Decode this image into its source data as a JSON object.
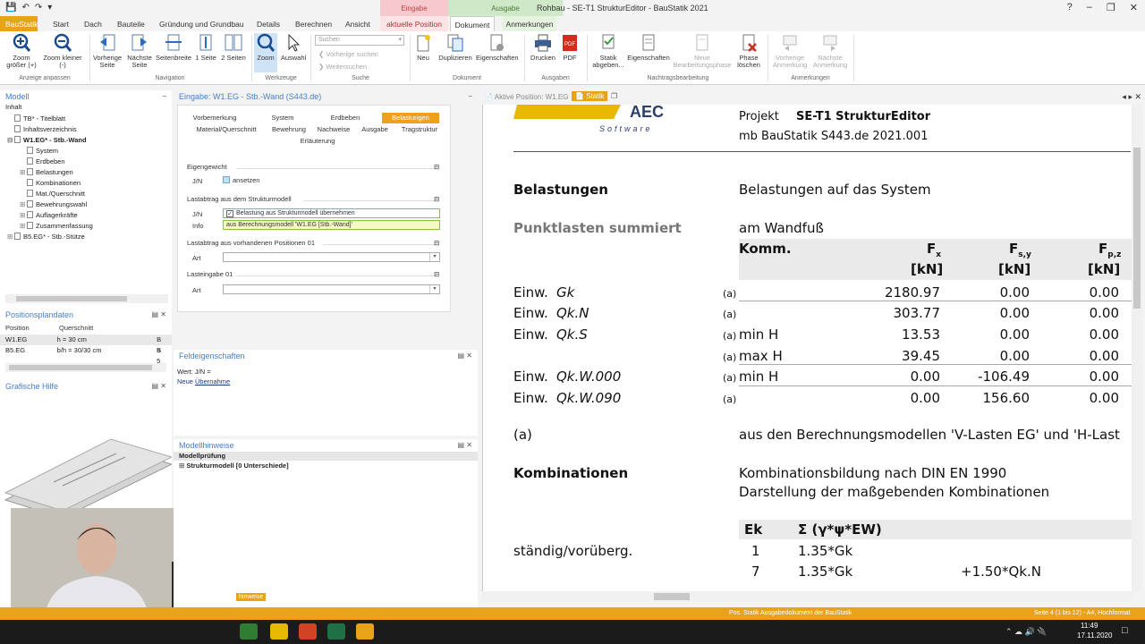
{
  "titlebar": {
    "title": "Rohbau - SE-T1 StrukturEditor - BauStatik 2021",
    "ctx_eingabe": "Eingabe",
    "ctx_ausgabe": "Ausgabe",
    "ctx_eingabe_tab": "aktuelle Position"
  },
  "tabs": [
    "BauStatik",
    "Start",
    "Dach",
    "Bauteile",
    "Gründung und Grundbau",
    "Details",
    "Berechnen",
    "Ansicht",
    "aktuelle Position",
    "Dokument",
    "Anmerkungen"
  ],
  "ribbon": {
    "zoom_plus": "Zoom größer (+)",
    "zoom_minus": "Zoom kleiner (-)",
    "group_anzeige": "Anzeige anpassen",
    "prev_page": "Vorherige Seite",
    "next_page": "Nächste Seite",
    "page_width": "Seitenbreite",
    "one_page": "1 Seite",
    "two_pages": "2 Seiten",
    "group_nav": "Navigation",
    "zoom": "Zoom",
    "select": "Auswahl",
    "group_werkzeuge": "Werkzeuge",
    "search_placeholder": "Suchen",
    "search_prev": "Vorherige suchen",
    "search_next": "Weitersuchen",
    "group_suche": "Suche",
    "neu": "Neu",
    "duplizieren": "Duplizieren",
    "eigenschaften": "Eigenschaften",
    "group_dokument": "Dokument",
    "drucken": "Drucken",
    "pdf": "PDF",
    "group_ausgaben": "Ausgaben",
    "statik_abgeben": "Statik abgeben...",
    "eigenschaften2": "Eigenschaften",
    "neue_bearbeitungsphase": "Neue Bearbeitungsphase",
    "phase_loeschen": "Phase löschen",
    "group_nachtrag": "Nachtragsbearbeitung",
    "vorherige_anm": "Vorherige Anmerkung",
    "naechste_anm": "Nächste Anmerkung",
    "group_anmerkungen": "Anmerkungen"
  },
  "modell": {
    "title": "Modell",
    "inhalt": "Inhalt",
    "tree": [
      {
        "label": "TB* - Titelblatt",
        "level": 1,
        "exp": ""
      },
      {
        "label": "Inhaltsverzeichnis",
        "level": 1,
        "exp": ""
      },
      {
        "label": "W1.EG* - Stb.-Wand",
        "level": 1,
        "exp": "−",
        "bold": true
      },
      {
        "label": "System",
        "level": 2,
        "exp": ""
      },
      {
        "label": "Erdbeben",
        "level": 2,
        "exp": ""
      },
      {
        "label": "Belastungen",
        "level": 2,
        "exp": "+"
      },
      {
        "label": "Kombinationen",
        "level": 2,
        "exp": ""
      },
      {
        "label": "Mat./Querschnitt",
        "level": 2,
        "exp": ""
      },
      {
        "label": "Bewehrungswahl",
        "level": 2,
        "exp": "+"
      },
      {
        "label": "Auflagerkräfte",
        "level": 2,
        "exp": "+"
      },
      {
        "label": "Zusammenfassung",
        "level": 2,
        "exp": "+"
      },
      {
        "label": "B5.EG* - Stb.-Stütze",
        "level": 1,
        "exp": "+"
      }
    ]
  },
  "positionsplan": {
    "title": "Positionsplandaten",
    "headers": [
      "Position",
      "Querschnitt"
    ],
    "rows": [
      [
        "W1.EG",
        "h = 30 cm",
        "B 5"
      ],
      [
        "B5.EG",
        "b/h = 30/30 cm",
        "B 5"
      ]
    ]
  },
  "grafik": {
    "title": "Grafische Hilfe"
  },
  "eingabe": {
    "title": "Eingabe: W1.EG - Stb.-Wand (S443.de)",
    "subtabs_row1": [
      "Vorbemerkung",
      "System",
      "Erdbeben",
      "Belastungen"
    ],
    "subtabs_row2": [
      "Material/Querschnitt",
      "Bewehrung",
      "Nachweise",
      "Ausgabe",
      "Tragstruktur"
    ],
    "subtabs_row3": [
      "Erläuterung"
    ],
    "sec_eigengewicht": "Eigengewicht",
    "jn": "J/N",
    "ansetzen": "ansetzen",
    "sec_lastabtrag_struktur": "Lastabtrag aus dem Strukturmodell",
    "info": "Info",
    "uebernehmen": "Belastung aus Strukturmodell übernehmen",
    "info_value": "aus Berechnungsmodell 'W1.EG [Stb.-Wand]'",
    "sec_lastabtrag_pos": "Lastabtrag aus vorhandenen Positionen 01",
    "art": "Art",
    "sec_lasteingabe": "Lasteingabe 01"
  },
  "feld": {
    "title": "Feldeigenschaften",
    "wert": "Wert: J/N =",
    "neue": "Neue ",
    "uebernahme": "Übernahme"
  },
  "hinweise": {
    "title": "Modellhinweise",
    "pruefung": "Modellprüfung",
    "struktur": "Strukturmodell [0 Unterschiede]",
    "hinweise_tab": "hinweise"
  },
  "doc": {
    "tab_active_pos": "Aktive Position: W1.EG",
    "tab_statik": "Statik",
    "logo_sub": "Software",
    "projekt_label": "Projekt",
    "projekt_value": "SE-T1 StrukturEditor",
    "firma": "mb BauStatik S443.de  2021.001",
    "belastungen": "Belastungen",
    "belastungen_desc": "Belastungen auf das System",
    "punktlasten": "Punktlasten summiert",
    "wandfuss": "am Wandfuß",
    "col_komm": "Komm.",
    "col_fx": "F",
    "col_fx_sub": "x",
    "col_fsy": "F",
    "col_fsy_sub": "s,y",
    "col_fpz": "F",
    "col_fpz_sub": "p,z",
    "unit": "[kN]",
    "rows": [
      {
        "pre": "Einw. ",
        "name": "Gk",
        "ref": "(a)",
        "komm": "",
        "fx": "2180.97",
        "fsy": "0.00",
        "fpz": "0.00"
      },
      {
        "pre": "Einw. ",
        "name": "Qk.N",
        "ref": "(a)",
        "komm": "",
        "fx": "303.77",
        "fsy": "0.00",
        "fpz": "0.00"
      },
      {
        "pre": "Einw. ",
        "name": "Qk.S",
        "ref": "(a)",
        "komm": "min H",
        "fx": "13.53",
        "fsy": "0.00",
        "fpz": "0.00"
      },
      {
        "pre": "",
        "name": "",
        "ref": "(a)",
        "komm": "max H",
        "fx": "39.45",
        "fsy": "0.00",
        "fpz": "0.00"
      },
      {
        "pre": "Einw. ",
        "name": "Qk.W.000",
        "ref": "(a)",
        "komm": "min H",
        "fx": "0.00",
        "fsy": "-106.49",
        "fpz": "0.00"
      },
      {
        "pre": "Einw. ",
        "name": "Qk.W.090",
        "ref": "(a)",
        "komm": "",
        "fx": "0.00",
        "fsy": "156.60",
        "fpz": "0.00"
      }
    ],
    "footnote_ref": "(a)",
    "footnote_text": "aus den Berechnungsmodellen 'V-Lasten EG' und 'H-Last",
    "kombinationen": "Kombinationen",
    "komb_desc1": "Kombinationsbildung nach DIN EN 1990",
    "komb_desc2": "Darstellung der maßgebenden Kombinationen",
    "col_ek": "Ek",
    "col_sum": "Σ (γ*ψ*EW)",
    "staendig": "ständig/vorüberg.",
    "komb_rows": [
      {
        "ek": "1",
        "a": "1.35*Gk",
        "b": ""
      },
      {
        "ek": "7",
        "a": "1.35*Gk",
        "b": "+1.50*Qk.N"
      }
    ]
  },
  "status": {
    "center": "Pos. Statik  Ausgabedokument der BauStatik",
    "right": "Seite 4 (1 bis 12) - A4, Hochformat"
  },
  "taskbar": {
    "time": "11:49",
    "date": "17.11.2020"
  },
  "colors": {
    "accent": "#e8a31a",
    "link": "#4a7fc0",
    "tab_on": "#f0a020"
  }
}
